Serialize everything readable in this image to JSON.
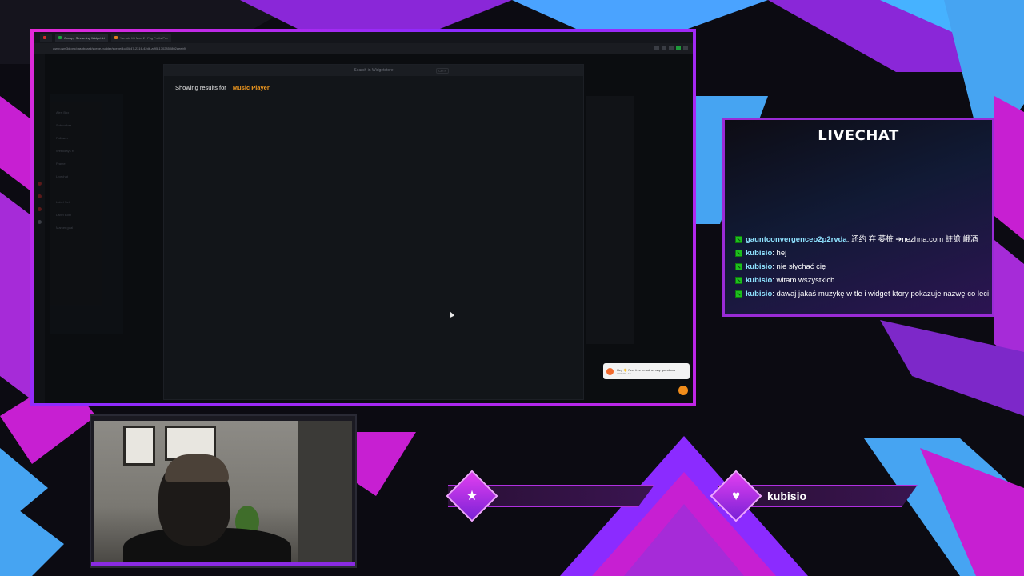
{
  "browser": {
    "tabs": [
      {
        "label": "Occupy Streaming Widget Li",
        "color": "#21a341"
      },
      {
        "label": "Yamato Mt Mod 2 | Fog Fruits Pro",
        "color": "#e07b20"
      }
    ],
    "url": "www.own3d.pro/dashboard/scene-builder/scene/4c80847-2316-42db-af95-1702850802aeeb9",
    "sidebar_items": [
      "Alert Box",
      "Subscriber",
      "Follower",
      "Weekdays R",
      "Frame",
      "Livechat",
      "Label Self",
      "Label Both",
      "Marker goal"
    ],
    "search_modal": {
      "placeholder": "Search in Widgetstore",
      "shortcut": "Ctrl F",
      "results_prefix": "Showing results for",
      "results_query": "Music Player"
    },
    "toast": {
      "text": "Hey 👋 Feel free to ask us any questions",
      "sub": "OWN3D · 1m"
    }
  },
  "livechat": {
    "title": "LIVECHAT",
    "messages": [
      {
        "user": "gauntconvergenceo2p2rvda",
        "text": " 还约 弃 萎桩 ➔nezhna.com 註譫 峨酒"
      },
      {
        "user": "kubisio",
        "text": " hej"
      },
      {
        "user": "kubisio",
        "text": " nie słychać cię"
      },
      {
        "user": "kubisio",
        "text": " witam wszystkich"
      },
      {
        "user": "kubisio",
        "text": " dawaj jakaś muzykę w tle i widget ktory pokazuje nazwę co leci"
      }
    ]
  },
  "overlay": {
    "star_icon": "star-icon",
    "heart_icon": "heart-icon",
    "latest_follower": "kubisio",
    "accent": "#b030e0",
    "secondary": "#46a4f2"
  }
}
